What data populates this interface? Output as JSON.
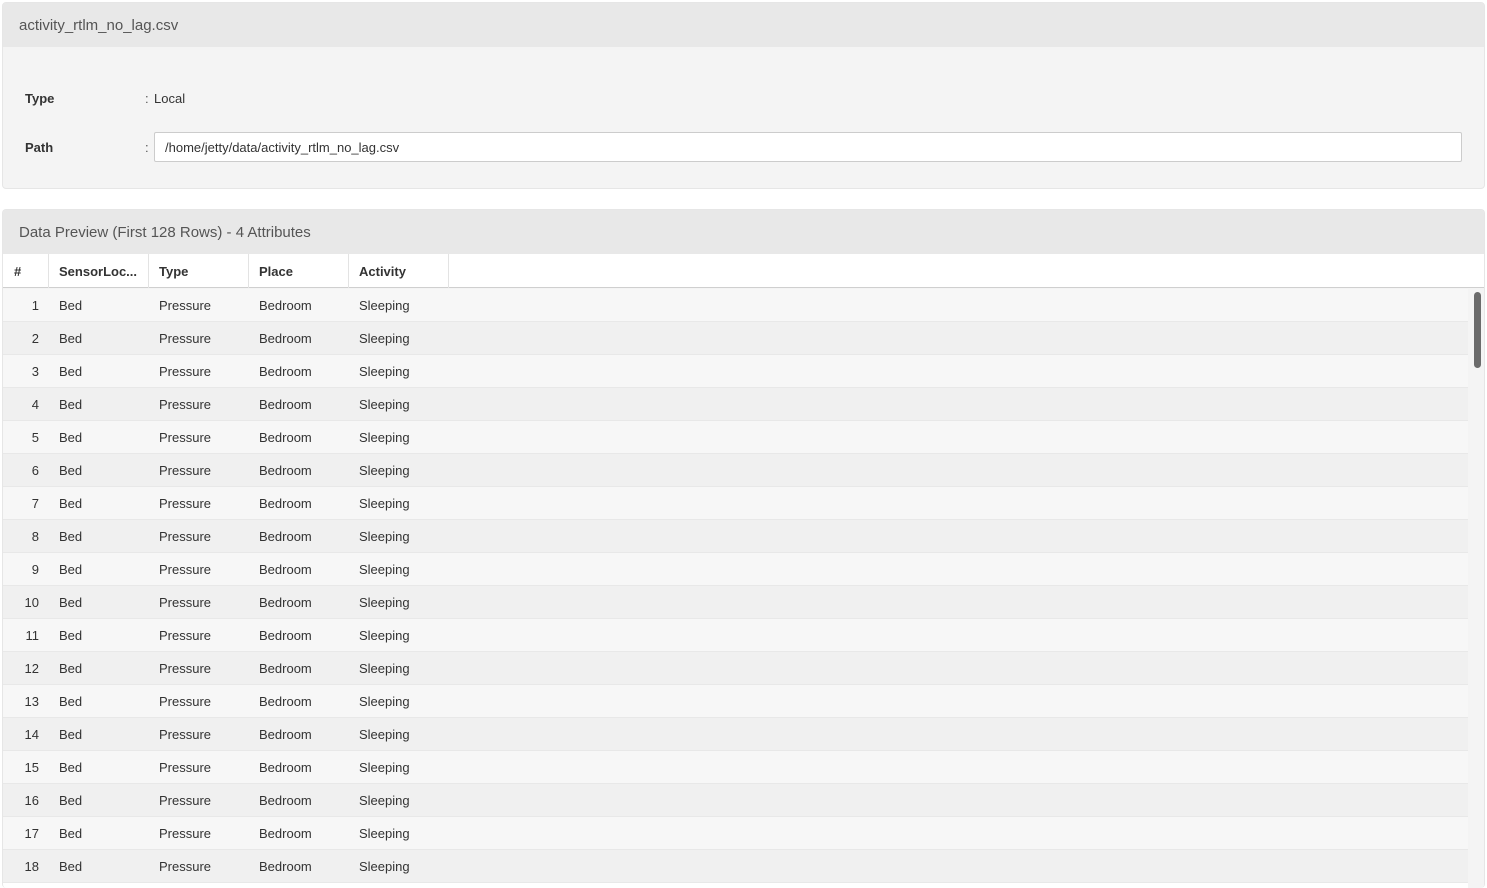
{
  "file": {
    "title": "activity_rtlm_no_lag.csv",
    "type_label": "Type",
    "type_value": "Local",
    "path_label": "Path",
    "path_value": "/home/jetty/data/activity_rtlm_no_lag.csv",
    "colon": ":"
  },
  "preview": {
    "title": "Data Preview (First 128 Rows) - 4 Attributes",
    "columns": [
      "#",
      "SensorLoc...",
      "Type",
      "Place",
      "Activity"
    ],
    "rows": [
      [
        "1",
        "Bed",
        "Pressure",
        "Bedroom",
        "Sleeping"
      ],
      [
        "2",
        "Bed",
        "Pressure",
        "Bedroom",
        "Sleeping"
      ],
      [
        "3",
        "Bed",
        "Pressure",
        "Bedroom",
        "Sleeping"
      ],
      [
        "4",
        "Bed",
        "Pressure",
        "Bedroom",
        "Sleeping"
      ],
      [
        "5",
        "Bed",
        "Pressure",
        "Bedroom",
        "Sleeping"
      ],
      [
        "6",
        "Bed",
        "Pressure",
        "Bedroom",
        "Sleeping"
      ],
      [
        "7",
        "Bed",
        "Pressure",
        "Bedroom",
        "Sleeping"
      ],
      [
        "8",
        "Bed",
        "Pressure",
        "Bedroom",
        "Sleeping"
      ],
      [
        "9",
        "Bed",
        "Pressure",
        "Bedroom",
        "Sleeping"
      ],
      [
        "10",
        "Bed",
        "Pressure",
        "Bedroom",
        "Sleeping"
      ],
      [
        "11",
        "Bed",
        "Pressure",
        "Bedroom",
        "Sleeping"
      ],
      [
        "12",
        "Bed",
        "Pressure",
        "Bedroom",
        "Sleeping"
      ],
      [
        "13",
        "Bed",
        "Pressure",
        "Bedroom",
        "Sleeping"
      ],
      [
        "14",
        "Bed",
        "Pressure",
        "Bedroom",
        "Sleeping"
      ],
      [
        "15",
        "Bed",
        "Pressure",
        "Bedroom",
        "Sleeping"
      ],
      [
        "16",
        "Bed",
        "Pressure",
        "Bedroom",
        "Sleeping"
      ],
      [
        "17",
        "Bed",
        "Pressure",
        "Bedroom",
        "Sleeping"
      ],
      [
        "18",
        "Bed",
        "Pressure",
        "Bedroom",
        "Sleeping"
      ]
    ]
  }
}
